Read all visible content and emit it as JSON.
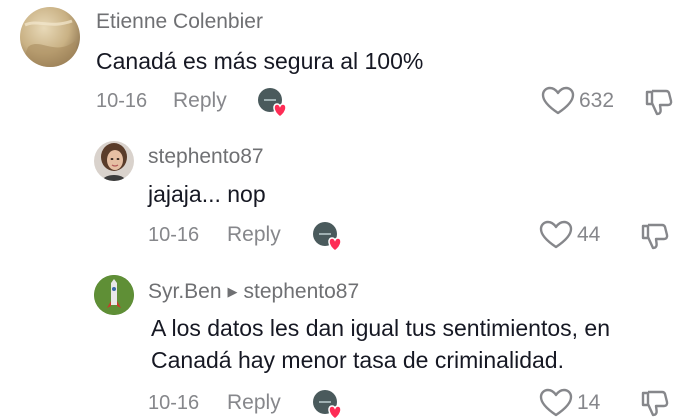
{
  "comments": [
    {
      "username": "Etienne Colenbier",
      "text_lines": [
        "Canadá es más segura al 100%"
      ],
      "date": "10-16",
      "reply_label": "Reply",
      "likes": "632"
    },
    {
      "username": "stephento87",
      "text_lines": [
        "jajaja... nop"
      ],
      "date": "10-16",
      "reply_label": "Reply",
      "likes": "44"
    },
    {
      "username": "Syr.Ben",
      "reply_to": "stephento87",
      "text_lines": [
        "A los datos les dan igual tus sentimientos, en",
        "Canadá hay menor tasa de criminalidad."
      ],
      "date": "10-16",
      "reply_label": "Reply",
      "likes": "14"
    }
  ],
  "colors": {
    "heart_badge": "#fe2c55",
    "muted_text": "#86878b",
    "primary_text": "#161823"
  },
  "icons": {
    "like": "heart-outline-icon",
    "dislike": "thumbs-down-icon",
    "creator_liked": "creator-liked-badge-icon",
    "reply_arrow": "right-triangle-icon"
  }
}
